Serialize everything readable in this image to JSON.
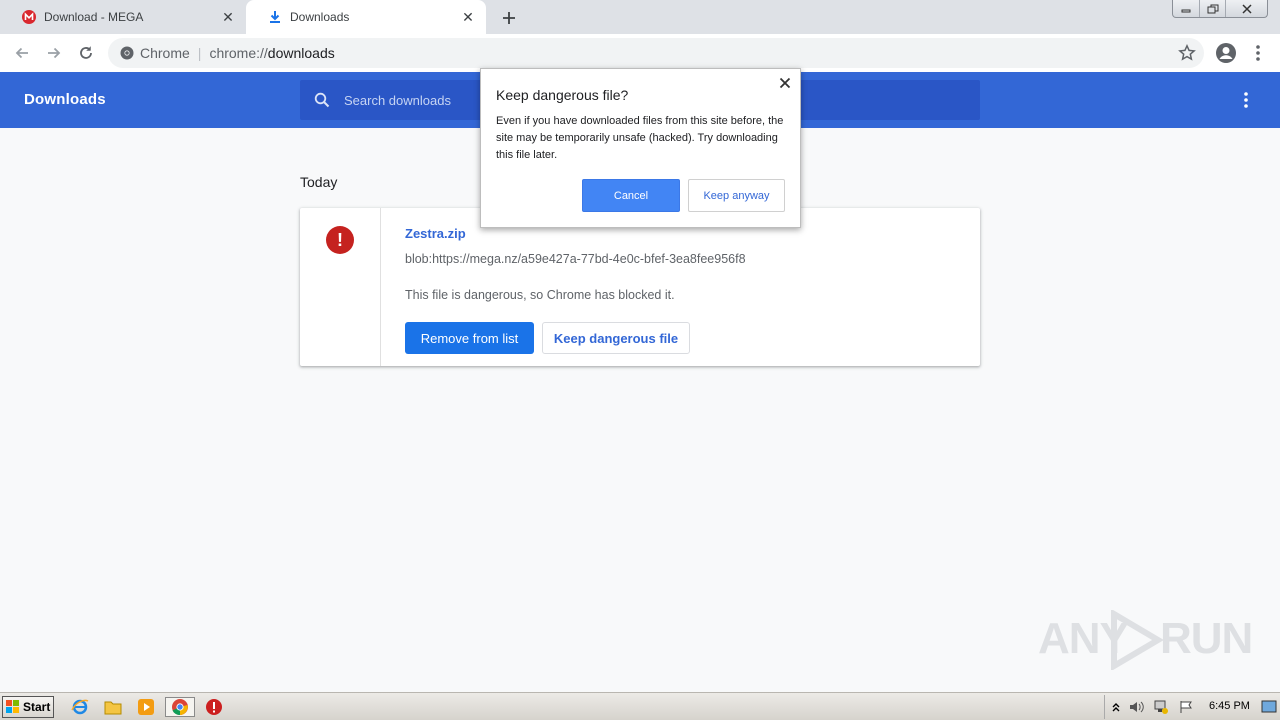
{
  "browser": {
    "tabs": [
      {
        "title": "Download - MEGA",
        "icon": "mega-icon"
      },
      {
        "title": "Downloads",
        "icon": "download-arrow-icon"
      }
    ],
    "omnibox": {
      "chip": "Chrome",
      "url_prefix": "chrome://",
      "url_host": "downloads"
    }
  },
  "downloads": {
    "header_title": "Downloads",
    "search_placeholder": "Search downloads",
    "section_label": "Today",
    "item": {
      "file_name": "Zestra.zip",
      "url": "blob:https://mega.nz/a59e427a-77bd-4e0c-bfef-3ea8fee956f8",
      "status": "This file is dangerous, so Chrome has blocked it.",
      "remove_label": "Remove from list",
      "keep_label": "Keep dangerous file"
    }
  },
  "dialog": {
    "title": "Keep dangerous file?",
    "body": "Even if you have downloaded files from this site before, the site may be temporarily unsafe (hacked). Try downloading this file later.",
    "cancel_label": "Cancel",
    "keep_label": "Keep anyway"
  },
  "taskbar": {
    "start_label": "Start",
    "clock": "6:45 PM"
  },
  "watermark": {
    "text_left": "ANY",
    "text_right": "RUN"
  },
  "colors": {
    "header_blue": "#3367d6",
    "primary_button": "#1a73e8",
    "danger_red": "#c5221f"
  }
}
